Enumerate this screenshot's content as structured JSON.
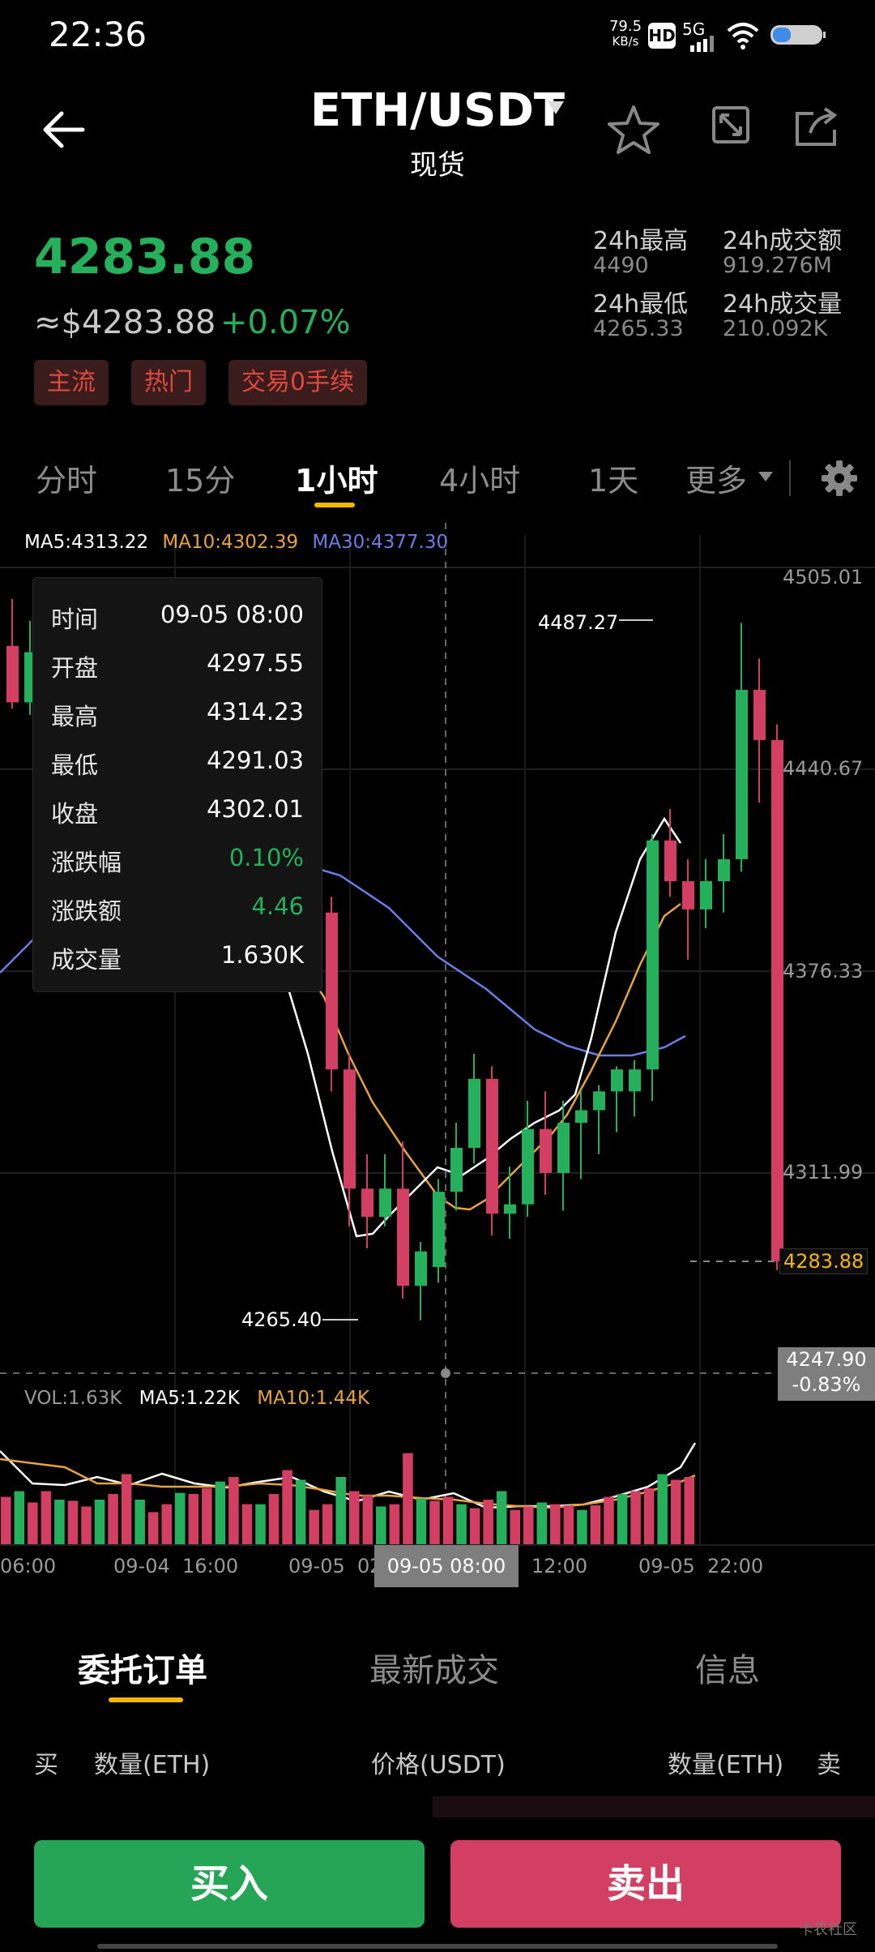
{
  "status": {
    "time": "22:36",
    "speed_value": "79.5",
    "speed_unit": "KB/s",
    "hd": "HD",
    "network": "5G"
  },
  "header": {
    "pair": "ETH/USDT",
    "market_type": "现货"
  },
  "price": {
    "last": "4283.88",
    "usd": "≈$4283.88",
    "change_pct": "+0.07%",
    "color_up": "#25b05c",
    "color_down": "#d23f62"
  },
  "tags": [
    "主流",
    "热门",
    "交易0手续"
  ],
  "stats": {
    "high_label": "24h最高",
    "high_value": "4490",
    "low_label": "24h最低",
    "low_value": "4265.33",
    "turnover_label": "24h成交额",
    "turnover_value": "919.276M",
    "volume_label": "24h成交量",
    "volume_value": "210.092K"
  },
  "intervals": {
    "items": [
      "分时",
      "15分",
      "1小时",
      "4小时",
      "1天"
    ],
    "active": "1小时",
    "more": "更多"
  },
  "indicators": {
    "ma5": "MA5:4313.22",
    "ma10": "MA10:4302.39",
    "ma30": "MA30:4377.30",
    "ma5_color": "#ffffff",
    "ma10_color": "#e8a33a",
    "ma30_color": "#6b7ee8"
  },
  "price_axis": [
    "4505.01",
    "4440.67",
    "4376.33",
    "4311.99"
  ],
  "current_price_label": "4283.88",
  "cursor": {
    "price": "4247.90",
    "pct": "-0.83%",
    "time_label": "09-05 08:00"
  },
  "annotations": {
    "high": "4487.27",
    "low": "4265.40"
  },
  "volume": {
    "vol": "VOL:1.63K",
    "ma5": "MA5:1.22K",
    "ma10": "MA10:1.44K"
  },
  "time_axis": [
    "06:00",
    "09-04  16:00",
    "09-05  02",
    "12:00",
    "09-05  22:00"
  ],
  "tooltip": {
    "rows": [
      {
        "label": "时间",
        "value": "09-05 08:00"
      },
      {
        "label": "开盘",
        "value": "4297.55"
      },
      {
        "label": "最高",
        "value": "4314.23"
      },
      {
        "label": "最低",
        "value": "4291.03"
      },
      {
        "label": "收盘",
        "value": "4302.01"
      },
      {
        "label": "涨跌幅",
        "value": "0.10%"
      },
      {
        "label": "涨跌额",
        "value": "4.46"
      },
      {
        "label": "成交量",
        "value": "1.630K"
      }
    ]
  },
  "chart_data": {
    "type": "candlestick",
    "price_range": [
      4247.9,
      4505.01
    ],
    "candles": [
      {
        "o": 4480,
        "h": 4495,
        "l": 4460,
        "c": 4462
      },
      {
        "o": 4462,
        "h": 4488,
        "l": 4458,
        "c": 4478
      },
      {
        "o": 4400,
        "h": 4408,
        "l": 4385,
        "c": 4396
      },
      {
        "o": 4396,
        "h": 4405,
        "l": 4386,
        "c": 4390
      },
      {
        "o": 4390,
        "h": 4402,
        "l": 4382,
        "c": 4400
      },
      {
        "o": 4395,
        "h": 4400,
        "l": 4338,
        "c": 4345
      },
      {
        "o": 4345,
        "h": 4350,
        "l": 4295,
        "c": 4307
      },
      {
        "o": 4307,
        "h": 4318,
        "l": 4288,
        "c": 4298
      },
      {
        "o": 4298,
        "h": 4318,
        "l": 4295,
        "c": 4307
      },
      {
        "o": 4307,
        "h": 4322,
        "l": 4272,
        "c": 4276
      },
      {
        "o": 4276,
        "h": 4290,
        "l": 4265,
        "c": 4287
      },
      {
        "o": 4282,
        "h": 4310,
        "l": 4277,
        "c": 4306
      },
      {
        "o": 4306,
        "h": 4328,
        "l": 4300,
        "c": 4320
      },
      {
        "o": 4320,
        "h": 4350,
        "l": 4315,
        "c": 4342
      },
      {
        "o": 4342,
        "h": 4346,
        "l": 4292,
        "c": 4299
      },
      {
        "o": 4299,
        "h": 4314,
        "l": 4291,
        "c": 4302
      },
      {
        "o": 4302,
        "h": 4335,
        "l": 4298,
        "c": 4326
      },
      {
        "o": 4326,
        "h": 4338,
        "l": 4305,
        "c": 4312
      },
      {
        "o": 4312,
        "h": 4335,
        "l": 4300,
        "c": 4328
      },
      {
        "o": 4328,
        "h": 4338,
        "l": 4310,
        "c": 4332
      },
      {
        "o": 4332,
        "h": 4340,
        "l": 4318,
        "c": 4338
      },
      {
        "o": 4338,
        "h": 4346,
        "l": 4325,
        "c": 4345
      },
      {
        "o": 4338,
        "h": 4348,
        "l": 4330,
        "c": 4345
      },
      {
        "o": 4345,
        "h": 4420,
        "l": 4335,
        "c": 4418
      },
      {
        "o": 4418,
        "h": 4428,
        "l": 4400,
        "c": 4405
      },
      {
        "o": 4405,
        "h": 4412,
        "l": 4380,
        "c": 4396
      },
      {
        "o": 4396,
        "h": 4412,
        "l": 4390,
        "c": 4405
      },
      {
        "o": 4405,
        "h": 4420,
        "l": 4395,
        "c": 4412
      },
      {
        "o": 4412,
        "h": 4487.27,
        "l": 4408,
        "c": 4466
      },
      {
        "o": 4466,
        "h": 4476,
        "l": 4430,
        "c": 4450
      },
      {
        "o": 4450,
        "h": 4455,
        "l": 4281,
        "c": 4283.88
      }
    ],
    "volumes": [
      0.85,
      0.95,
      0.75,
      0.95,
      0.8,
      0.78,
      0.68,
      0.8,
      0.9,
      1.25,
      0.8,
      0.58,
      0.72,
      0.92,
      0.9,
      1.0,
      1.12,
      1.2,
      0.72,
      0.72,
      0.9,
      1.32,
      1.15,
      0.62,
      0.72,
      1.2,
      0.95,
      0.88,
      0.68,
      0.72,
      1.62,
      0.82,
      0.78,
      0.85,
      0.72,
      0.65,
      0.8,
      0.95,
      0.62,
      0.68,
      0.75,
      0.72,
      0.7,
      0.62,
      0.7,
      0.85,
      0.9,
      0.95,
      1.0,
      1.25,
      1.15,
      1.2
    ]
  },
  "bottom_tabs": {
    "items": [
      "委托订单",
      "最新成交",
      "信息"
    ],
    "active": "委托订单"
  },
  "orderbook_header": {
    "buy": "买",
    "qty_left": "数量(ETH)",
    "price": "价格(USDT)",
    "qty_right": "数量(ETH)",
    "sell": "卖"
  },
  "actions": {
    "buy": "买入",
    "sell": "卖出"
  },
  "watermark": "卡农社区"
}
